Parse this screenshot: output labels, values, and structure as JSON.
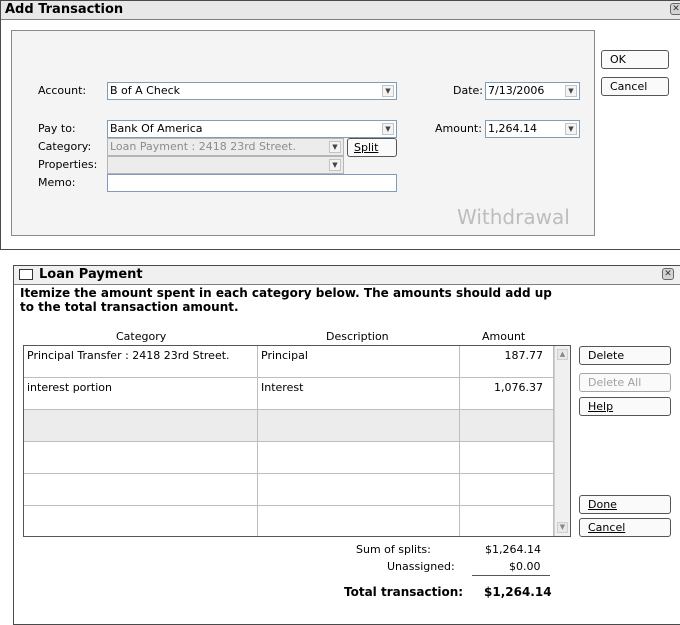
{
  "add_transaction": {
    "title": "Add Transaction",
    "account_label": "Account:",
    "account_value": "B of A Check",
    "payto_label": "Pay to:",
    "payto_value": "Bank Of America",
    "category_label": "Category:",
    "category_value": "Loan Payment : 2418 23rd Street.",
    "split_label": "Split",
    "properties_label": "Properties:",
    "properties_value": "",
    "memo_label": "Memo:",
    "memo_value": "",
    "date_label": "Date:",
    "date_value": "7/13/2006",
    "amount_label": "Amount:",
    "amount_value": "1,264.14",
    "type_watermark": "Withdrawal",
    "ok_label": "OK",
    "cancel_label": "Cancel"
  },
  "loan_payment": {
    "title": "Loan Payment",
    "instructions": "Itemize the amount spent in each category below. The amounts should add up to the total transaction amount.",
    "columns": {
      "category": "Category",
      "description": "Description",
      "amount": "Amount"
    },
    "rows": [
      {
        "category": "Principal Transfer : 2418 23rd Street.",
        "description": "Principal",
        "amount": "187.77"
      },
      {
        "category": "interest portion",
        "description": "Interest",
        "amount": "1,076.37"
      },
      {
        "category": "",
        "description": "",
        "amount": ""
      },
      {
        "category": "",
        "description": "",
        "amount": ""
      },
      {
        "category": "",
        "description": "",
        "amount": ""
      },
      {
        "category": "",
        "description": "",
        "amount": ""
      }
    ],
    "buttons": {
      "delete": "Delete",
      "delete_all": "Delete All",
      "help": "Help",
      "done": "Done",
      "cancel": "Cancel"
    },
    "summary": {
      "sum_label": "Sum of splits:",
      "sum_value": "$1,264.14",
      "unassigned_label": "Unassigned:",
      "unassigned_value": "$0.00",
      "total_label": "Total transaction:",
      "total_value": "$1,264.14"
    }
  }
}
